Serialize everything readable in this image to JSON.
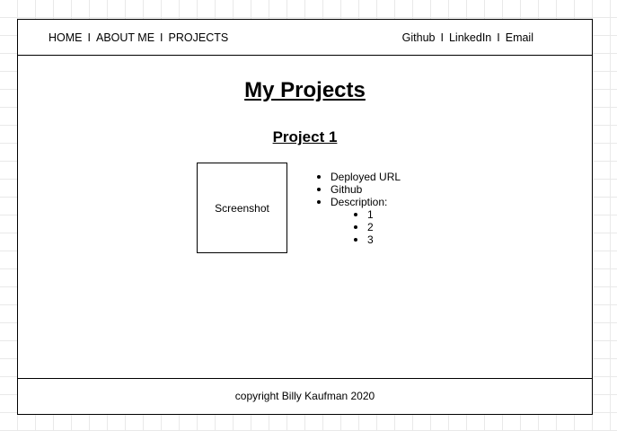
{
  "nav": {
    "left": [
      {
        "label": "HOME"
      },
      {
        "label": "ABOUT ME"
      },
      {
        "label": "PROJECTS"
      }
    ],
    "right": [
      {
        "label": "Github"
      },
      {
        "label": "LinkedIn"
      },
      {
        "label": "Email"
      }
    ],
    "separator": "I"
  },
  "main": {
    "title": "My Projects",
    "project": {
      "title": "Project 1",
      "screenshot_label": "Screenshot",
      "details": {
        "deployed_url": "Deployed URL",
        "github": "Github",
        "description": "Description:",
        "description_items": [
          "1",
          "2",
          "3"
        ]
      }
    }
  },
  "footer": {
    "text": "copyright Billy Kaufman 2020"
  }
}
